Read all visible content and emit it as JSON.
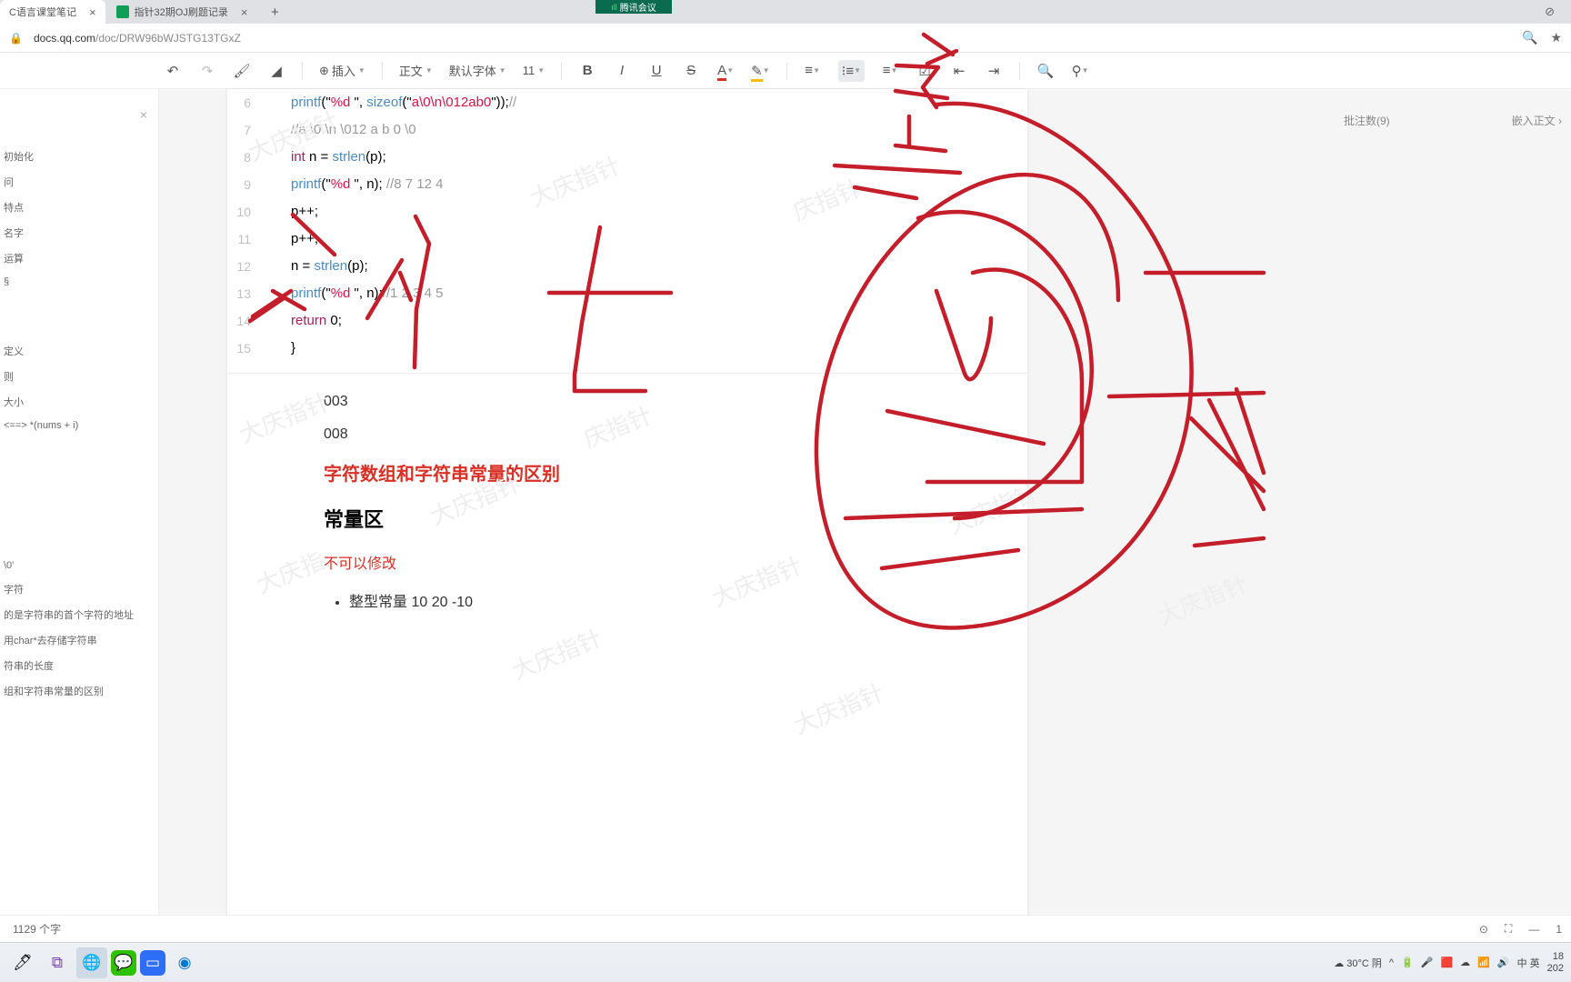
{
  "meeting_bar": "腾讯会议",
  "tabs": {
    "tab1": "C语言课堂笔记",
    "tab2": "指针32期OJ刷题记录"
  },
  "url_full": "docs.qq.com/doc/DRW96bWJSTG13TGxZ",
  "url_domain": "docs.qq.com",
  "url_path": "/doc/DRW96bWJSTG13TGxZ",
  "toolbar": {
    "insert": "插入",
    "body": "正文",
    "font": "默认字体",
    "size": "11"
  },
  "sidebar": {
    "items": [
      "初始化",
      "问",
      "特点",
      "名字",
      "运算",
      "§",
      "",
      "定义",
      "则",
      "大小",
      "<==> *(nums + i)",
      "",
      "\\0'",
      "字符",
      "的是字符串的首个字符的地址",
      "用char*去存储字符串",
      "符串的长度",
      "组和字符串常量的区别"
    ]
  },
  "code": {
    "line6_a": "printf",
    "line6_b": "(\"",
    "line6_c": "%d ",
    "line6_d": "\", ",
    "line6_e": "sizeof",
    "line6_f": "(\"",
    "line6_g": "a\\0\\n\\012ab0",
    "line6_h": "\"));",
    "line6_i": "//",
    "line7": "//a  \\0  \\n   \\012   a   b   0   \\0",
    "line8_a": "int",
    "line8_b": " n = ",
    "line8_c": "strlen",
    "line8_d": "(p);",
    "line9_a": "printf",
    "line9_b": "(\"",
    "line9_c": "%d ",
    "line9_d": "\", n);",
    "line9_e": "   //8    7    12    4",
    "line10": "p++;",
    "line11": "p++;",
    "line12_a": "n = ",
    "line12_b": "strlen",
    "line12_c": "(p);",
    "line13_a": "printf",
    "line13_b": "(\"",
    "line13_c": "%d ",
    "line13_d": "\", n);",
    "line13_e": "//1    2    3    4    5",
    "line14_a": "return",
    "line14_b": "   0;",
    "line15": "}"
  },
  "prose": {
    "p1": "003",
    "p2": "008",
    "h1": "字符数组和字符串常量的区别",
    "h2": "常量区",
    "p3": "不可以修改",
    "li1": "整型常量   10   20   -10"
  },
  "right": {
    "comments": "批注数(9)",
    "embed": "嵌入正文"
  },
  "status": {
    "words": "1129 个字"
  },
  "tray": {
    "weather": "30°C 阴",
    "ime1": "中",
    "ime2": "英",
    "time": "18",
    "date": "202"
  }
}
